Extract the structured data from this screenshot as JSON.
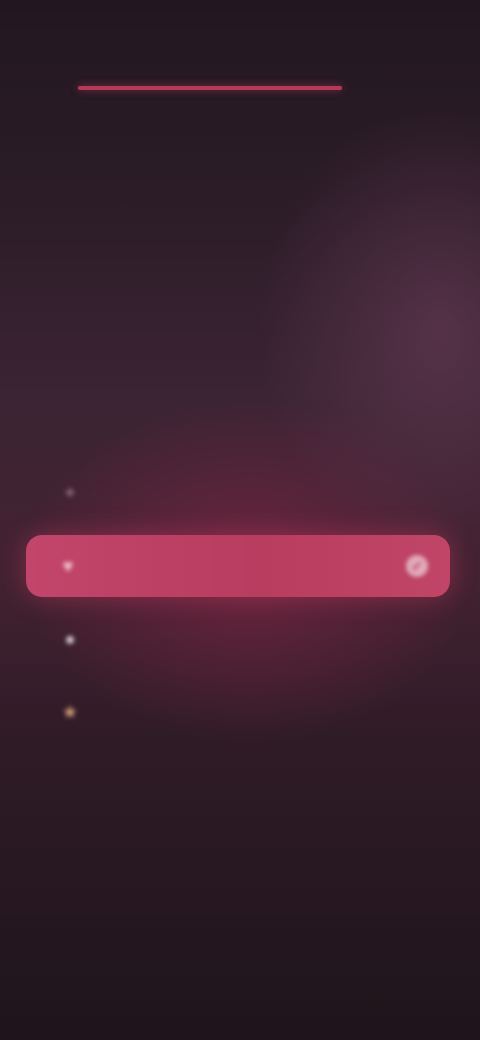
{
  "status_bar": {
    "time": "",
    "indicators": ""
  },
  "onboarding": {
    "progress_fraction": 1.0,
    "headline": "",
    "subheadline": ""
  },
  "options": [
    {
      "label": "",
      "icon": "sparkle-icon",
      "icon_color": "#8a6a78",
      "selected": false
    },
    {
      "label": "",
      "icon": "heart-icon",
      "icon_color": "#f0c9d4",
      "selected": true
    },
    {
      "label": "",
      "icon": "chat-icon",
      "icon_color": "#d8d0d6",
      "selected": false
    },
    {
      "label": "",
      "icon": "star-icon",
      "icon_color": "#d9a37a",
      "selected": false
    }
  ],
  "colors": {
    "accent": "#c2456b",
    "background_top": "#221720",
    "background_mid": "#442232",
    "background_bottom": "#1f141b"
  },
  "footer": {
    "hint": ""
  }
}
